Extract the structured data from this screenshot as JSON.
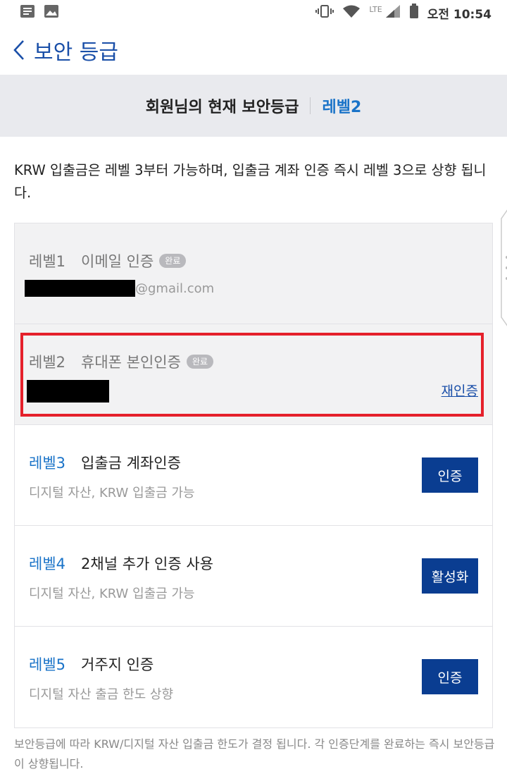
{
  "status_bar": {
    "time": "오전 10:54",
    "network": "LTE",
    "icons": [
      "notes-icon",
      "image-icon",
      "vibrate-icon",
      "wifi-icon",
      "signal-icon",
      "battery-icon"
    ]
  },
  "header": {
    "title": "보안 등급"
  },
  "banner": {
    "label": "회원님의 현재 보안등급",
    "level": "레벨2"
  },
  "notice": "KRW 입출금은 레벨 3부터 가능하며, 입출금 계좌 인증 즉시 레벨 3으로 상향 됩니다.",
  "levels": [
    {
      "num": "레벨1",
      "name": "이메일 인증",
      "badge": "완료",
      "detail": "@gmail.com"
    },
    {
      "num": "레벨2",
      "name": "휴대폰 본인인증",
      "badge": "완료",
      "link": "재인증"
    },
    {
      "num": "레벨3",
      "name": "입출금 계좌인증",
      "detail": "디지털 자산, KRW 입출금 가능",
      "button": "인증"
    },
    {
      "num": "레벨4",
      "name": "2채널 추가 인증 사용",
      "detail": "디지털 자산, KRW 입출금 가능",
      "button": "활성화"
    },
    {
      "num": "레벨5",
      "name": "거주지 인증",
      "detail": "디지털 자산 출금 한도 상향",
      "button": "인증"
    }
  ],
  "footer_note": "보안등급에 따라 KRW/디지털 자산 입출금 한도가 결정 됩니다. 각 인증단계를 완료하는 즉시 보안등급이 상향됩니다.",
  "colors": {
    "accent_blue": "#1a73c8",
    "button_navy": "#0a3d91",
    "highlight_red": "#e5202b"
  }
}
